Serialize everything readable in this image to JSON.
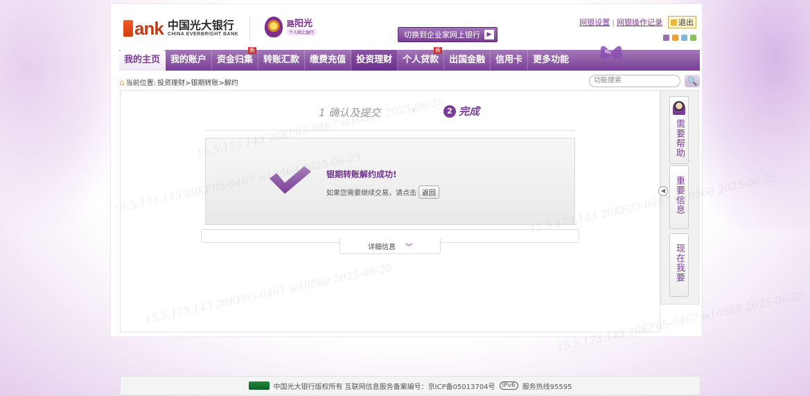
{
  "brand": {
    "logo_letter": "B",
    "logo_word": "ank",
    "name_cn": "中国光大银行",
    "name_en": "CHINA EVERBRIGHT BANK",
    "service_name": "阳光",
    "service_sub": "个人网上银行"
  },
  "header": {
    "switch_label": "切换到企业家网上银行",
    "links": [
      "网银设置",
      "网银操作记录"
    ],
    "exit_label": "退出"
  },
  "nav": {
    "items": [
      {
        "label": "我的主页"
      },
      {
        "label": "我的账户"
      },
      {
        "label": "资金归集",
        "badge": "新"
      },
      {
        "label": "转账汇款"
      },
      {
        "label": "缴费充值"
      },
      {
        "label": "投资理财"
      },
      {
        "label": "个人贷款",
        "badge": "新"
      },
      {
        "label": "出国金融"
      },
      {
        "label": "信用卡"
      },
      {
        "label": "更多功能"
      }
    ]
  },
  "breadcrumb": {
    "prefix": "当前位置:",
    "path": "投资理财>银期转账>解约"
  },
  "search": {
    "placeholder": "功能搜索"
  },
  "steps": {
    "step1": "1 确认及提交",
    "step2_num": "2",
    "step2": "完成"
  },
  "result": {
    "title": "银期转账解约成功!",
    "text": "如果您需要继续交易，请点击",
    "back_label": "返回"
  },
  "detail": {
    "label": "详细信息"
  },
  "sidebar": {
    "help": "需要帮助",
    "important": "重要信息",
    "want": "现在我要"
  },
  "footer": {
    "text": "中国光大银行版权所有 互联网信息服务备案编号：京ICP备05013704号",
    "ipv6": "IPv6",
    "hotline": "服务热线95595"
  },
  "watermark": {
    "text": "15.5.173.143 20KF05-0467 w10568 2025-06-25"
  },
  "colors": {
    "brand_purple": "#7a3d97",
    "brand_orange": "#d13b10",
    "badge_red": "#d62c2c"
  }
}
